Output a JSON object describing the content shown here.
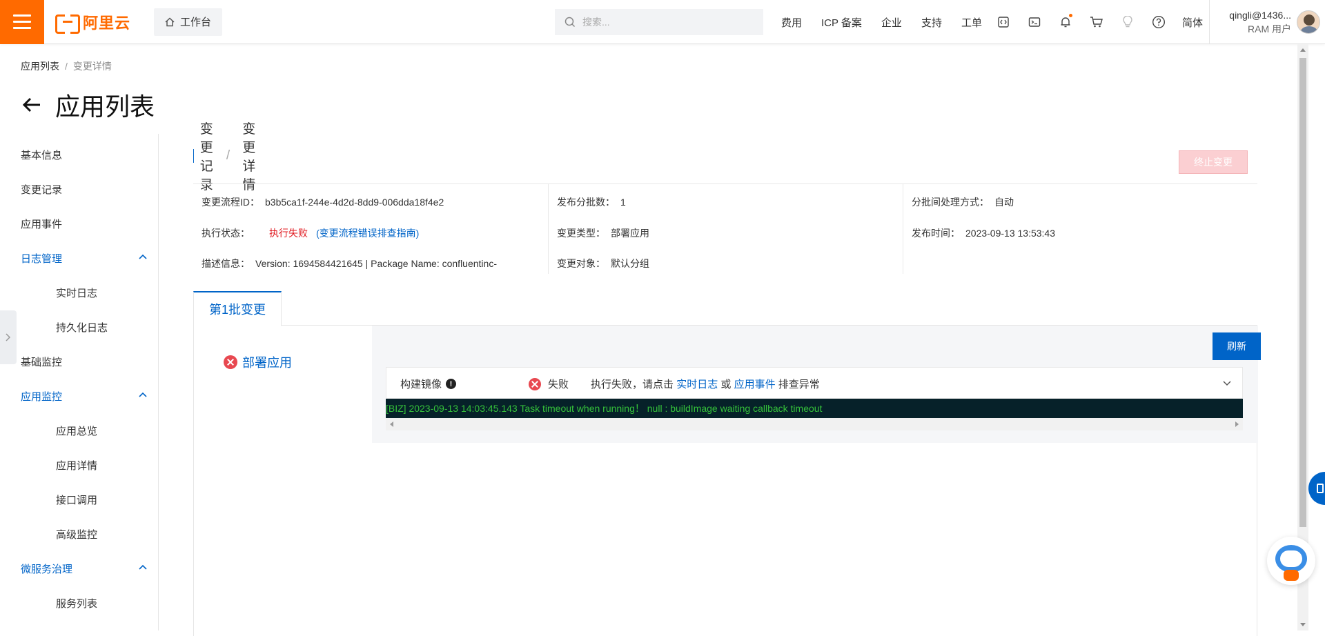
{
  "topbar": {
    "logo_text": "阿里云",
    "workbench_label": "工作台",
    "search_placeholder": "搜索...",
    "nav_items": [
      "费用",
      "ICP 备案",
      "企业",
      "支持",
      "工单"
    ],
    "lang": "简体",
    "user_name": "qingli@1436...",
    "user_role": "RAM 用户",
    "icons": [
      "code-icon",
      "terminal-icon",
      "bell-icon",
      "cart-icon",
      "lightbulb-icon",
      "help-icon"
    ]
  },
  "breadcrumb": {
    "items": [
      "应用列表",
      "变更详情"
    ]
  },
  "page": {
    "title": "应用列表"
  },
  "leftnav": {
    "items": [
      {
        "label": "基本信息",
        "type": "item"
      },
      {
        "label": "变更记录",
        "type": "item"
      },
      {
        "label": "应用事件",
        "type": "item"
      },
      {
        "label": "日志管理",
        "type": "group"
      },
      {
        "label": "实时日志",
        "type": "sub"
      },
      {
        "label": "持久化日志",
        "type": "sub"
      },
      {
        "label": "基础监控",
        "type": "item"
      },
      {
        "label": "应用监控",
        "type": "group"
      },
      {
        "label": "应用总览",
        "type": "sub"
      },
      {
        "label": "应用详情",
        "type": "sub"
      },
      {
        "label": "接口调用",
        "type": "sub"
      },
      {
        "label": "高级监控",
        "type": "sub"
      },
      {
        "label": "微服务治理",
        "type": "group"
      },
      {
        "label": "服务列表",
        "type": "sub"
      }
    ]
  },
  "main": {
    "sub_breadcrumb": [
      "变更记录",
      "变更详情"
    ],
    "stop_button": "终止变更",
    "info": {
      "flow_id_label": "变更流程ID：",
      "flow_id": "b3b5ca1f-244e-4d2d-8dd9-006dda18f4e2",
      "exec_status_label": "执行状态：",
      "exec_status": "执行失败",
      "exec_guide": "(变更流程错误排查指南)",
      "desc_label": "描述信息：",
      "desc": "Version: 1694584421645 | Package Name: confluentinc-",
      "batch_count_label": "发布分批数：",
      "batch_count": "1",
      "change_type_label": "变更类型：",
      "change_type": "部署应用",
      "change_target_label": "变更对象：",
      "change_target": "默认分组",
      "batch_mode_label": "分批间处理方式：",
      "batch_mode": "自动",
      "publish_time_label": "发布时间：",
      "publish_time": "2023-09-13 13:53:43"
    },
    "tab_label": "第1批变更",
    "step_label": "部署应用",
    "refresh_label": "刷新",
    "task": {
      "name": "构建镜像",
      "status": "失败",
      "msg_prefix": "执行失败，请点击",
      "link1": "实时日志",
      "or": "或",
      "link2": "应用事件",
      "msg_suffix": "排查异常"
    },
    "log_line": "[BIZ] 2023-09-13 14:03:45.143 Task timeout when running！ null : buildImage waiting callback timeout"
  }
}
